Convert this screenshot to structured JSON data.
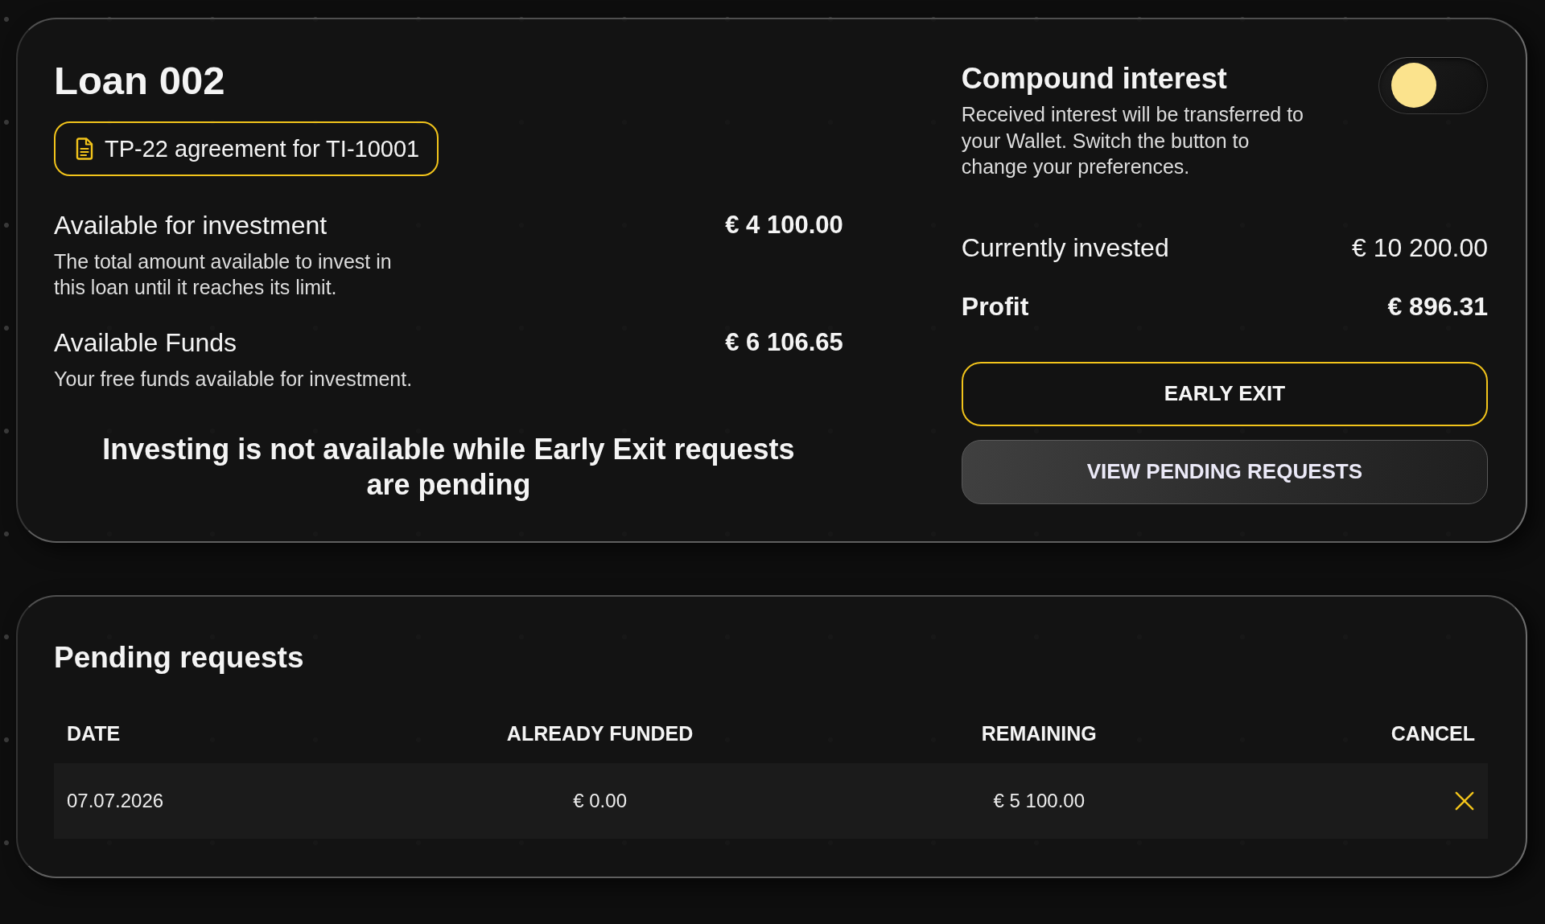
{
  "loan": {
    "title": "Loan 002",
    "agreement_link": "TP-22 agreement for TI-10001",
    "metrics": [
      {
        "label": "Available for investment",
        "value": "€ 4 100.00",
        "description": "The total amount available to invest in this loan until it reaches its limit."
      },
      {
        "label": "Available Funds",
        "value": "€ 6 106.65",
        "description": "Your free funds available for investment."
      }
    ],
    "notice": "Investing is not available while Early Exit requests are pending"
  },
  "compound_interest": {
    "title": "Compound interest",
    "description": "Received interest will be transferred to your Wallet. Switch the button to change your preferences.",
    "on": false
  },
  "summary": [
    {
      "label": "Currently invested",
      "value": "€ 10 200.00",
      "kind": "plain"
    },
    {
      "label": "Profit",
      "value": "€ 896.31",
      "kind": "strong"
    }
  ],
  "buttons": [
    {
      "label": "EARLY EXIT",
      "kind": "outline"
    },
    {
      "label": "VIEW PENDING REQUESTS",
      "kind": "filled"
    }
  ],
  "pending_requests": {
    "title": "Pending requests",
    "columns": [
      "DATE",
      "ALREADY FUNDED",
      "REMAINING",
      "CANCEL"
    ],
    "rows": [
      {
        "date": "07.07.2026",
        "already_funded": "€ 0.00",
        "remaining": "€ 5 100.00"
      }
    ]
  }
}
